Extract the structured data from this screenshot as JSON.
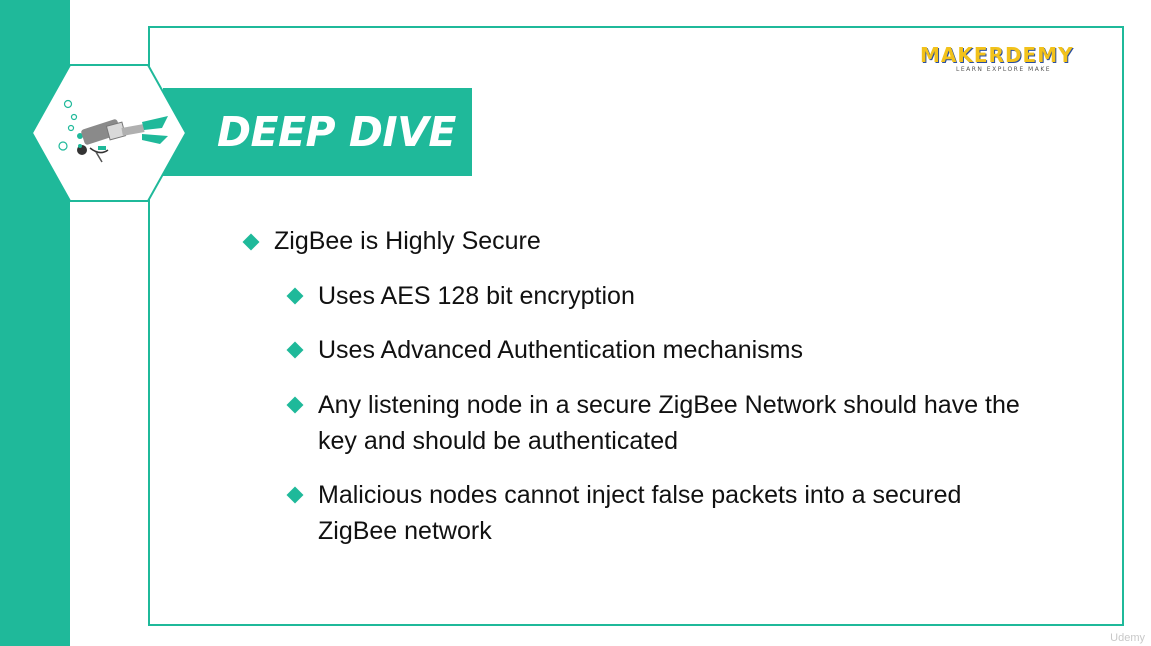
{
  "slide": {
    "title": "DEEP DIVE",
    "logo": {
      "name": "MAKERDEMY",
      "tagline": "LEARN EXPLORE MAKE"
    },
    "bullets": [
      {
        "level": 1,
        "lines": [
          "ZigBee is Highly Secure"
        ]
      },
      {
        "level": 2,
        "lines": [
          "Uses AES 128 bit encryption"
        ]
      },
      {
        "level": 2,
        "lines": [
          "Uses Advanced Authentication mechanisms"
        ]
      },
      {
        "level": 2,
        "lines": [
          "Any listening node in a secure ZigBee Network should have the",
          "key and should be authenticated"
        ]
      },
      {
        "level": 2,
        "lines": [
          "Malicious nodes cannot inject false packets into a secured",
          "ZigBee network"
        ]
      }
    ]
  },
  "watermark": "Udemy",
  "colors": {
    "accent": "#1fb99a",
    "text": "#111111",
    "logo_yellow": "#f2c21b",
    "logo_blue": "#2a4fa0"
  },
  "icons": {
    "banner_illustration": "scuba-diver-icon",
    "bullet": "diamond-bullet-icon"
  }
}
